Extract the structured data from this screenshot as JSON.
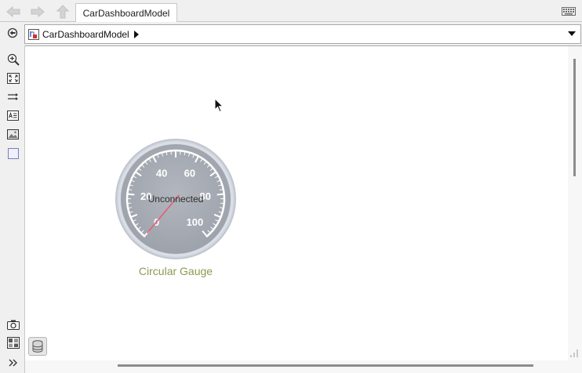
{
  "tabs": [
    {
      "label": "CarDashboardModel",
      "active": true
    }
  ],
  "breadcrumb": {
    "model_name": "CarDashboardModel"
  },
  "canvas": {
    "gauge": {
      "status_text": "Unconnected",
      "caption": "Circular Gauge",
      "tick_labels": [
        "0",
        "20",
        "40",
        "60",
        "80",
        "100"
      ],
      "range": [
        0,
        100
      ],
      "value": 0
    }
  },
  "colors": {
    "caption": "#8d9a50",
    "gauge_face": "#a7acb4",
    "needle": "#e85d75"
  }
}
